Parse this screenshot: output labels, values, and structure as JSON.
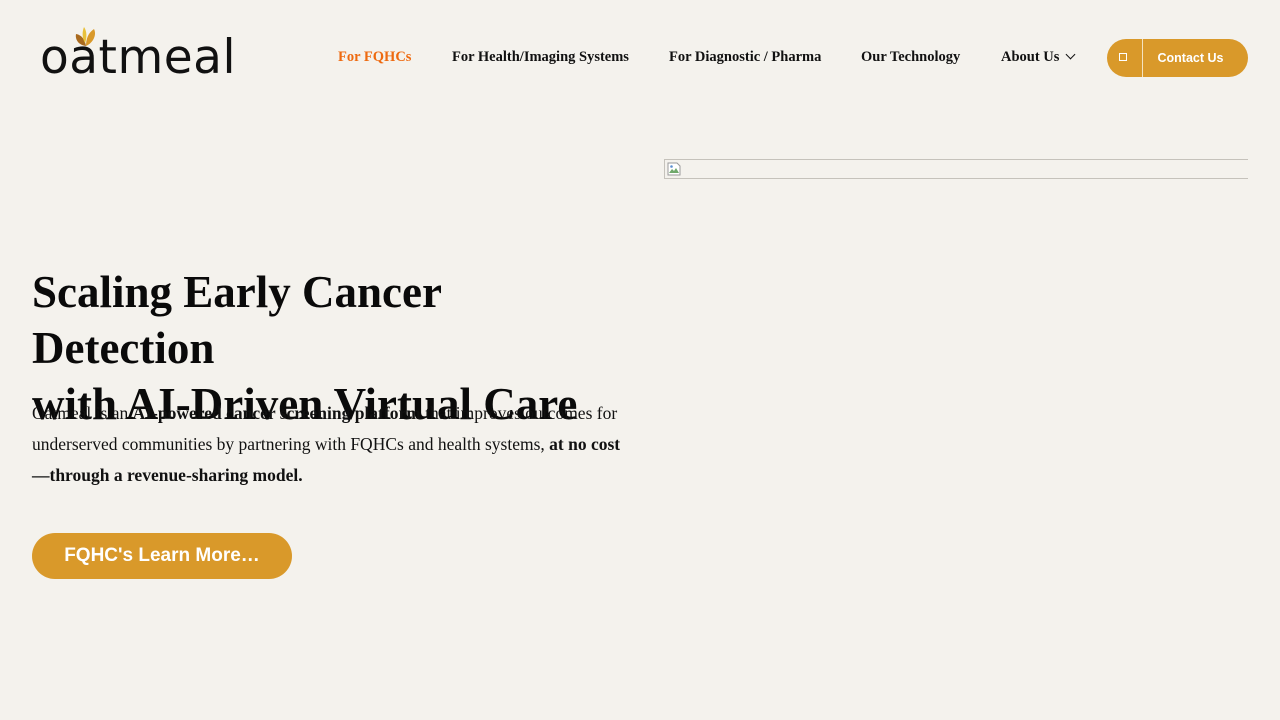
{
  "brand": {
    "logo_text": "oatmeal",
    "logo_icon": "leaf-sprout-icon",
    "accent_color": "#d9992a",
    "active_nav_color": "#ee6a10",
    "background_color": "#f4f2ed"
  },
  "nav": {
    "items": [
      {
        "label": "For FQHCs",
        "active": true
      },
      {
        "label": "For Health/Imaging Systems",
        "active": false
      },
      {
        "label": "For Diagnostic / Pharma",
        "active": false
      },
      {
        "label": "Our Technology",
        "active": false
      },
      {
        "label": "About Us",
        "active": false,
        "has_dropdown": true
      }
    ],
    "contact": {
      "icon": "square-icon",
      "label": "Contact Us"
    }
  },
  "hero": {
    "title_line1": "Scaling Early Cancer Detection",
    "title_line2": "with AI-Driven Virtual Care",
    "desc": {
      "part1": "Oatmeal is an ",
      "bold1": "AI-powered cancer screening platform",
      "part2": " that improves outcomes for underserved communities by partnering with FQHCs and health systems, ",
      "bold2": "at no cost —through a revenue-sharing model."
    },
    "cta_label": "FQHC's Learn More…",
    "image_icon": "broken-image-icon"
  }
}
